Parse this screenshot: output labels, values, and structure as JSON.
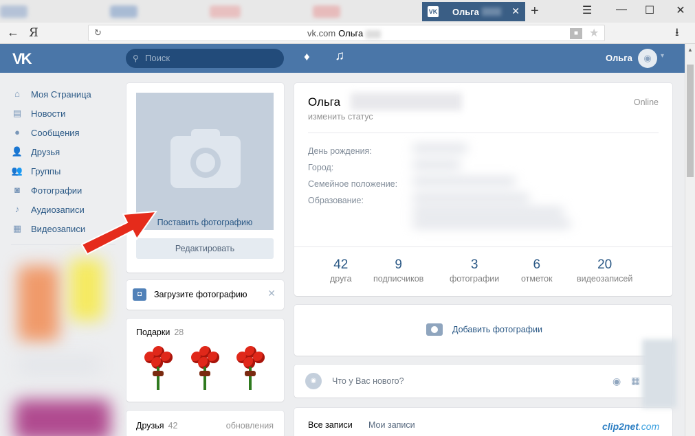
{
  "browser": {
    "tab_title": "Ольга",
    "tab_favicon": "VK",
    "tab_close": "✕",
    "new_tab": "+",
    "window_minimize": "☰",
    "window_min": "—",
    "window_max": "☐",
    "window_close": "✕",
    "back": "←",
    "yandex_logo": "Я",
    "reload": "↻",
    "url_domain": "vk.com",
    "url_title": "Ольга",
    "lock_icon": "🔒",
    "star_icon": "★",
    "download_icon": "⭳"
  },
  "header": {
    "logo": "VK",
    "search_placeholder": "Поиск",
    "search_icon": "⚲",
    "bell_icon": "🔔",
    "music_icon": "♫",
    "user_name": "Ольга",
    "avatar_icon": "📷",
    "chevron": "▾"
  },
  "sidebar": {
    "items": [
      {
        "label": "Моя Страница",
        "icon": "⌂"
      },
      {
        "label": "Новости",
        "icon": "▤"
      },
      {
        "label": "Сообщения",
        "icon": "●"
      },
      {
        "label": "Друзья",
        "icon": "👤"
      },
      {
        "label": "Группы",
        "icon": "👥"
      },
      {
        "label": "Фотографии",
        "icon": "◙"
      },
      {
        "label": "Аудиозаписи",
        "icon": "♪"
      },
      {
        "label": "Видеозаписи",
        "icon": "▦"
      }
    ]
  },
  "photo_block": {
    "put_photo": "Поставить фотографию",
    "edit_button": "Редактировать"
  },
  "upload_block": {
    "label": "Загрузите фотографию",
    "icon": "◘",
    "close": "✕"
  },
  "gifts": {
    "label": "Подарки",
    "count": "28"
  },
  "friends": {
    "label": "Друзья",
    "count": "42",
    "updates": "обновления"
  },
  "profile": {
    "name": "Ольга",
    "online": "Online",
    "status": "изменить статус",
    "info_labels": [
      "День рождения:",
      "Город:",
      "Семейное положение:",
      "Образование:"
    ],
    "counters": [
      {
        "num": "42",
        "label": "друга"
      },
      {
        "num": "9",
        "label": "подписчиков"
      },
      {
        "num": "3",
        "label": "фотографии"
      },
      {
        "num": "6",
        "label": "отметок"
      },
      {
        "num": "20",
        "label": "видеозаписей"
      }
    ]
  },
  "add_photos": {
    "label": "Добавить фотографии"
  },
  "post_box": {
    "placeholder": "Что у Вас нового?",
    "camera_icon": "📷",
    "video_icon": "▦"
  },
  "wall_tabs": {
    "all": "Все записи",
    "mine": "Мои записи"
  },
  "watermark": {
    "brand": "clip2net",
    "suffix": ".com"
  },
  "colors": {
    "vk_header": "#4a76a8",
    "link": "#2a5885",
    "arrow": "#e52b1b"
  }
}
